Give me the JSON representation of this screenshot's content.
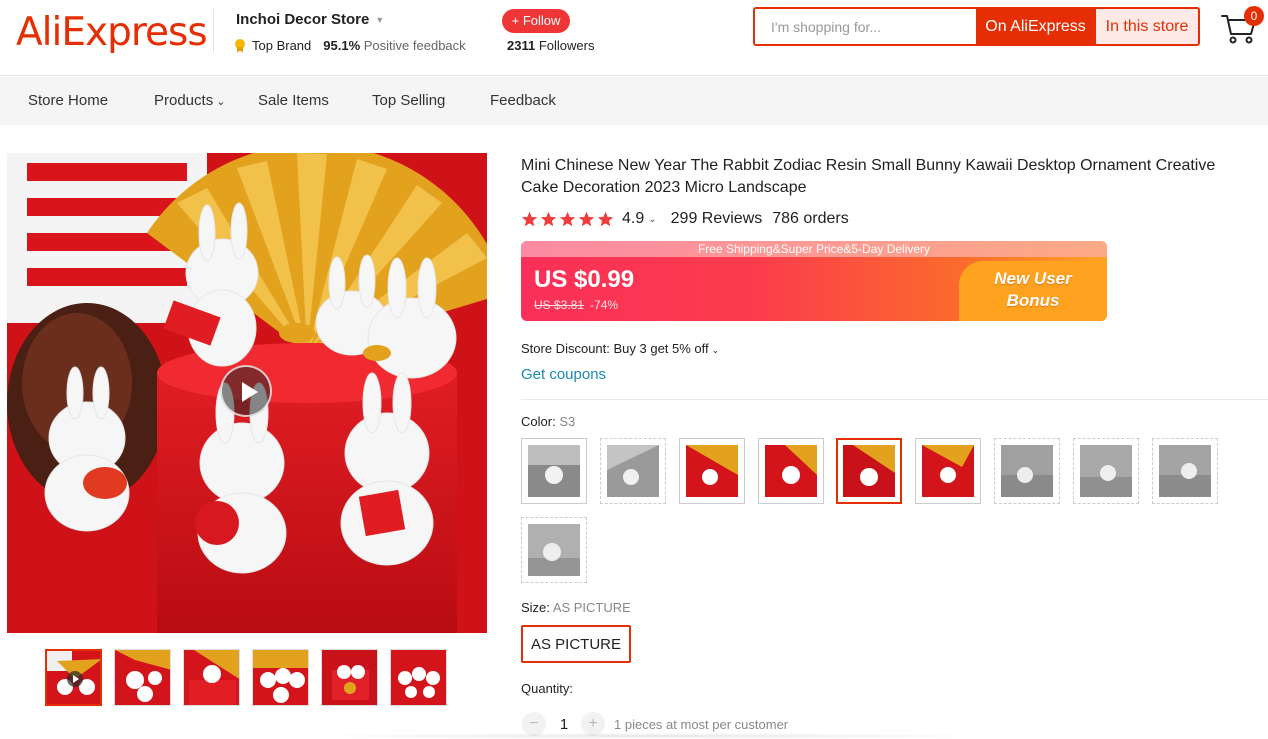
{
  "header": {
    "logo_text": "AliExpress",
    "store_name": "Inchoi Decor Store",
    "top_brand": "Top Brand",
    "positive_pct": "95.1%",
    "positive_label": "Positive feedback",
    "follow_label": "+ Follow",
    "followers_count": "2311",
    "followers_label": "Followers",
    "search_placeholder": "I'm shopping for...",
    "search_on_ae": "On AliExpress",
    "search_in_store": "In this store",
    "cart_count": "0"
  },
  "nav": {
    "items": [
      "Store Home",
      "Products",
      "Sale Items",
      "Top Selling",
      "Feedback"
    ]
  },
  "product": {
    "title": "Mini Chinese New Year The Rabbit Zodiac Resin Small Bunny Kawaii Desktop Ornament Creative Cake Decoration 2023 Micro Landscape",
    "rating": "4.9",
    "stars": 5,
    "reviews": "299 Reviews",
    "orders": "786 orders",
    "shipping_strip": "Free Shipping&Super Price&5-Day Delivery",
    "price": "US $0.99",
    "original_price": "US $3.81",
    "discount": "-74%",
    "bonus_line1": "New User",
    "bonus_line2": "Bonus",
    "store_discount": "Store Discount: Buy 3 get 5% off",
    "coupons": "Get coupons",
    "color_label": "Color:",
    "color_value": "S3",
    "size_label": "Size:",
    "size_value": "AS PICTURE",
    "size_option": "AS PICTURE",
    "quantity_label": "Quantity:",
    "quantity_minus": "−",
    "quantity_plus": "+",
    "quantity_value": "1",
    "quantity_note": "1 pieces at most per customer"
  },
  "colors": {
    "brand": "#e62e04",
    "link": "#1a89b8",
    "star": "#f03c3c"
  }
}
